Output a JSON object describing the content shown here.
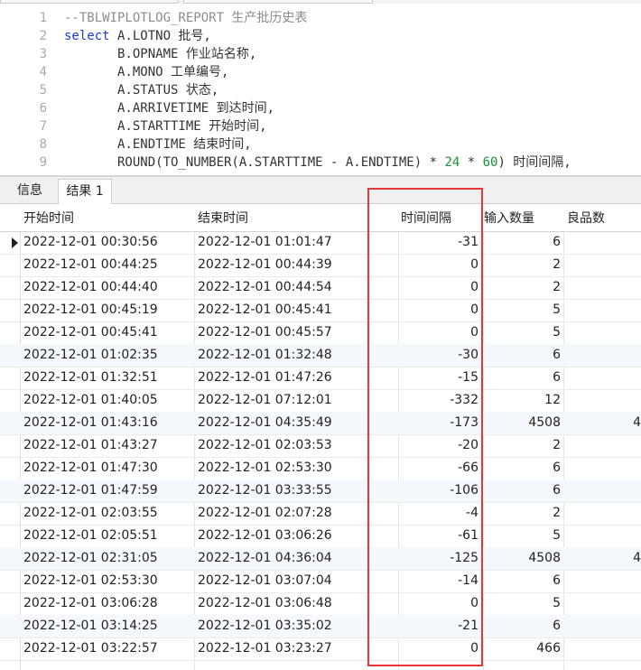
{
  "editor": {
    "lines": [
      {
        "n": "1",
        "parts": [
          {
            "t": "--TBLWIPLOTLOG_REPORT 生产批历史表",
            "c": "cm"
          }
        ]
      },
      {
        "n": "2",
        "parts": [
          {
            "t": "select",
            "c": "kw"
          },
          {
            "t": " A.LOTNO 批号,",
            "c": "tx"
          }
        ]
      },
      {
        "n": "3",
        "parts": [
          {
            "t": "       B.OPNAME 作业站名称,",
            "c": "tx"
          }
        ]
      },
      {
        "n": "4",
        "parts": [
          {
            "t": "       A.MONO 工单编号,",
            "c": "tx"
          }
        ]
      },
      {
        "n": "5",
        "parts": [
          {
            "t": "       A.STATUS 状态,",
            "c": "tx"
          }
        ]
      },
      {
        "n": "6",
        "parts": [
          {
            "t": "       A.ARRIVETIME 到达时间,",
            "c": "tx"
          }
        ]
      },
      {
        "n": "7",
        "parts": [
          {
            "t": "       A.STARTTIME 开始时间,",
            "c": "tx"
          }
        ]
      },
      {
        "n": "8",
        "parts": [
          {
            "t": "       A.ENDTIME 结束时间,",
            "c": "tx"
          }
        ]
      },
      {
        "n": "9",
        "parts": [
          {
            "t": "       ROUND(TO_NUMBER(A.STARTTIME - A.ENDTIME) * ",
            "c": "tx"
          },
          {
            "t": "24",
            "c": "nm"
          },
          {
            "t": " * ",
            "c": "tx"
          },
          {
            "t": "60",
            "c": "nm"
          },
          {
            "t": ") 时间间隔,",
            "c": "tx"
          }
        ]
      }
    ]
  },
  "tabs": {
    "info": "信息",
    "result": "结果 1"
  },
  "grid": {
    "columns": {
      "start": "开始时间",
      "end": "结束时间",
      "interval": "时间间隔",
      "input_qty": "输入数量",
      "good_qty": "良品数"
    },
    "rows": [
      {
        "start": "2022-12-01 00:30:56",
        "end": "2022-12-01 01:01:47",
        "interval": "-31",
        "input_qty": "6",
        "good_qty": ""
      },
      {
        "start": "2022-12-01 00:44:25",
        "end": "2022-12-01 00:44:39",
        "interval": "0",
        "input_qty": "2",
        "good_qty": ""
      },
      {
        "start": "2022-12-01 00:44:40",
        "end": "2022-12-01 00:44:54",
        "interval": "0",
        "input_qty": "2",
        "good_qty": ""
      },
      {
        "start": "2022-12-01 00:45:19",
        "end": "2022-12-01 00:45:41",
        "interval": "0",
        "input_qty": "5",
        "good_qty": ""
      },
      {
        "start": "2022-12-01 00:45:41",
        "end": "2022-12-01 00:45:57",
        "interval": "0",
        "input_qty": "5",
        "good_qty": ""
      },
      {
        "start": "2022-12-01 01:02:35",
        "end": "2022-12-01 01:32:48",
        "interval": "-30",
        "input_qty": "6",
        "good_qty": ""
      },
      {
        "start": "2022-12-01 01:32:51",
        "end": "2022-12-01 01:47:26",
        "interval": "-15",
        "input_qty": "6",
        "good_qty": ""
      },
      {
        "start": "2022-12-01 01:40:05",
        "end": "2022-12-01 07:12:01",
        "interval": "-332",
        "input_qty": "12",
        "good_qty": ""
      },
      {
        "start": "2022-12-01 01:43:16",
        "end": "2022-12-01 04:35:49",
        "interval": "-173",
        "input_qty": "4508",
        "good_qty": "4"
      },
      {
        "start": "2022-12-01 01:43:27",
        "end": "2022-12-01 02:03:53",
        "interval": "-20",
        "input_qty": "2",
        "good_qty": ""
      },
      {
        "start": "2022-12-01 01:47:30",
        "end": "2022-12-01 02:53:30",
        "interval": "-66",
        "input_qty": "6",
        "good_qty": ""
      },
      {
        "start": "2022-12-01 01:47:59",
        "end": "2022-12-01 03:33:55",
        "interval": "-106",
        "input_qty": "6",
        "good_qty": ""
      },
      {
        "start": "2022-12-01 02:03:55",
        "end": "2022-12-01 02:07:28",
        "interval": "-4",
        "input_qty": "2",
        "good_qty": ""
      },
      {
        "start": "2022-12-01 02:05:51",
        "end": "2022-12-01 03:06:26",
        "interval": "-61",
        "input_qty": "5",
        "good_qty": ""
      },
      {
        "start": "2022-12-01 02:31:05",
        "end": "2022-12-01 04:36:04",
        "interval": "-125",
        "input_qty": "4508",
        "good_qty": "4"
      },
      {
        "start": "2022-12-01 02:53:30",
        "end": "2022-12-01 03:07:04",
        "interval": "-14",
        "input_qty": "6",
        "good_qty": ""
      },
      {
        "start": "2022-12-01 03:06:28",
        "end": "2022-12-01 03:06:48",
        "interval": "0",
        "input_qty": "5",
        "good_qty": ""
      },
      {
        "start": "2022-12-01 03:14:25",
        "end": "2022-12-01 03:35:02",
        "interval": "-21",
        "input_qty": "6",
        "good_qty": ""
      },
      {
        "start": "2022-12-01 03:22:57",
        "end": "2022-12-01 03:23:27",
        "interval": "0",
        "input_qty": "466",
        "good_qty": ""
      }
    ]
  },
  "colors": {
    "highlight": "#e8373a",
    "keyword": "#1a3fd6",
    "comment": "#8c8c8c",
    "number": "#1e8f35"
  }
}
